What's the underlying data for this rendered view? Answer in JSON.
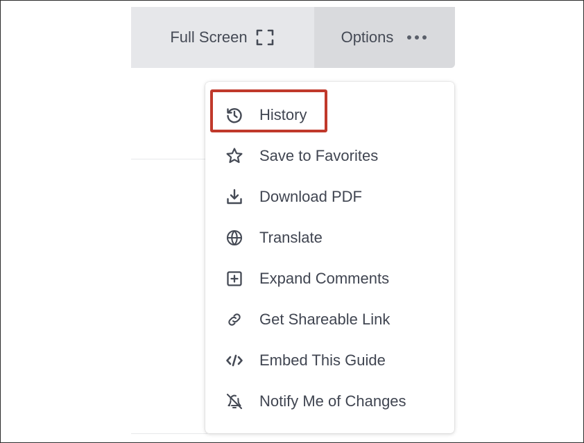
{
  "toolbar": {
    "fullscreen_label": "Full Screen",
    "fullscreen_icon": "fullscreen-icon",
    "options_label": "Options",
    "options_icon": "more-horizontal-icon"
  },
  "menu": {
    "items": [
      {
        "label": "History",
        "icon": "history-icon",
        "highlighted": true
      },
      {
        "label": "Save to Favorites",
        "icon": "star-icon"
      },
      {
        "label": "Download PDF",
        "icon": "download-icon"
      },
      {
        "label": "Translate",
        "icon": "globe-icon"
      },
      {
        "label": "Expand Comments",
        "icon": "plus-square-icon"
      },
      {
        "label": "Get Shareable Link",
        "icon": "link-icon"
      },
      {
        "label": "Embed This Guide",
        "icon": "code-icon"
      },
      {
        "label": "Notify Me of Changes",
        "icon": "bell-off-icon"
      }
    ]
  },
  "colors": {
    "highlight_border": "#c0392b",
    "text": "#404551",
    "toolbar_bg": "#e6e7ea",
    "options_bg": "#d9dadd"
  }
}
